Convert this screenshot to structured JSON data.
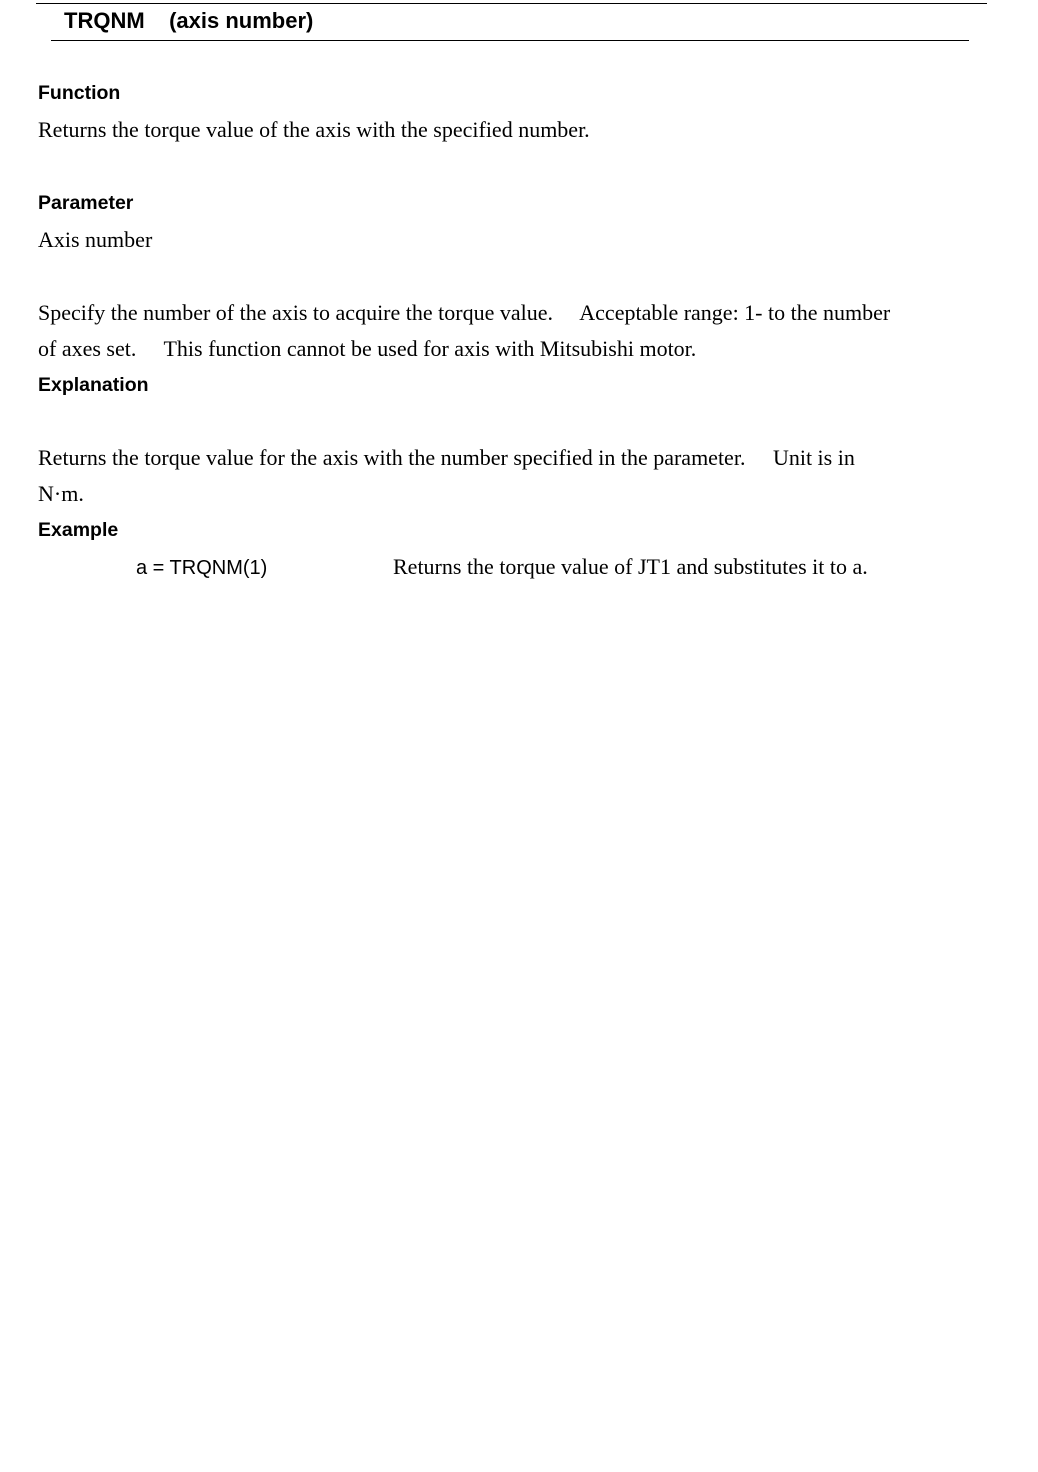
{
  "title": "TRQNM    (axis number)",
  "sections": {
    "function": {
      "heading": "Function",
      "text": "Returns the torque value of the axis with the specified number."
    },
    "parameter": {
      "heading": "Parameter",
      "name": "Axis number",
      "description_lines": [
        "Specify the number of the axis to acquire the torque value.     Acceptable range: 1- to the number",
        "of axes set.     This function cannot be used for axis with Mitsubishi motor."
      ]
    },
    "explanation": {
      "heading": "Explanation",
      "lines": [
        "Returns the torque value for the axis with the number specified in the parameter.     Unit is in",
        "N·m."
      ]
    },
    "example": {
      "heading": "Example",
      "code": "a = TRQNM(1)",
      "description": "Returns the torque value of JT1 and substitutes it to a."
    }
  }
}
